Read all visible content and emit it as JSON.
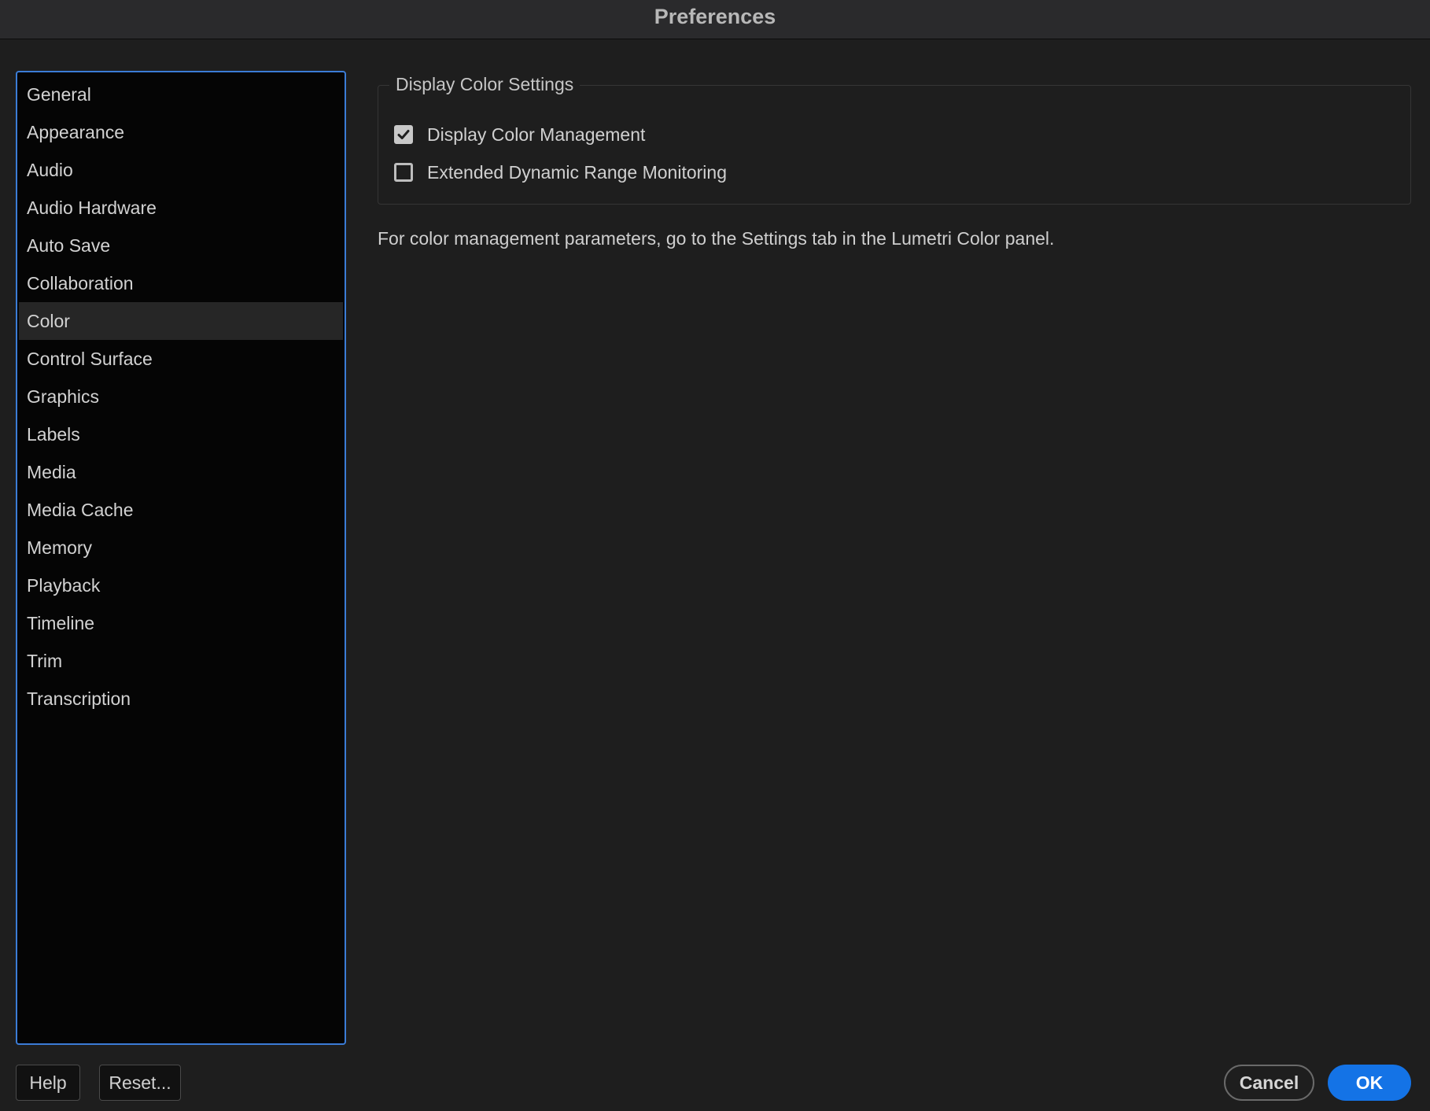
{
  "window": {
    "title": "Preferences"
  },
  "sidebar": {
    "selected": "Color",
    "items": [
      {
        "label": "General"
      },
      {
        "label": "Appearance"
      },
      {
        "label": "Audio"
      },
      {
        "label": "Audio Hardware"
      },
      {
        "label": "Auto Save"
      },
      {
        "label": "Collaboration"
      },
      {
        "label": "Color"
      },
      {
        "label": "Control Surface"
      },
      {
        "label": "Graphics"
      },
      {
        "label": "Labels"
      },
      {
        "label": "Media"
      },
      {
        "label": "Media Cache"
      },
      {
        "label": "Memory"
      },
      {
        "label": "Playback"
      },
      {
        "label": "Timeline"
      },
      {
        "label": "Trim"
      },
      {
        "label": "Transcription"
      }
    ]
  },
  "display_color_settings": {
    "legend": "Display Color Settings",
    "options": [
      {
        "label": "Display Color Management",
        "checked": true
      },
      {
        "label": "Extended Dynamic Range Monitoring",
        "checked": false
      }
    ]
  },
  "info": {
    "text": "For color management parameters, go to the Settings tab in the Lumetri Color panel."
  },
  "footer": {
    "help_label": "Help",
    "reset_label": "Reset...",
    "cancel_label": "Cancel",
    "ok_label": "OK"
  },
  "colors": {
    "accent": "#1473e6",
    "selection_border": "#3b7cd6",
    "background": "#1e1e1e",
    "sidebar_background": "#050505"
  }
}
